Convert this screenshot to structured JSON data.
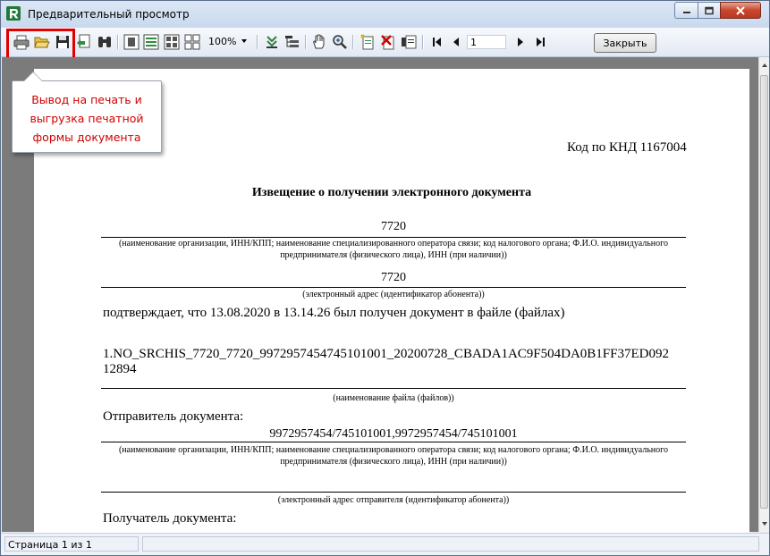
{
  "window": {
    "title": "Предварительный просмотр"
  },
  "toolbar": {
    "icons": [
      "print-icon",
      "open-icon",
      "save-icon",
      "export-icon",
      "find-icon",
      "view-one-page-icon",
      "view-page-width-icon",
      "view-multi-page-icon",
      "view-four-pages-icon",
      "outline-icon",
      "tree-icon",
      "hand-tool-icon",
      "zoom-tool-icon",
      "add-page-icon",
      "delete-page-icon",
      "edit-page-icon",
      "first-page-icon",
      "prev-page-icon",
      "next-page-icon",
      "last-page-icon"
    ],
    "zoom": "100%",
    "page_number": "1",
    "close_label": "Закрыть"
  },
  "tooltip": {
    "text": "Вывод на печать и выгрузка печатной формы документа"
  },
  "document": {
    "knd_code": "Код по КНД 1167004",
    "title": "Извещение о получении электронного документа",
    "org_value": "7720",
    "org_caption": "(наименование организации, ИНН/КПП; наименование специализированного оператора связи; код налогового органа; Ф.И.О. индивидуального предпринимателя (физического лица), ИНН (при наличии))",
    "address_value": "7720",
    "address_caption": "(электронный адрес (идентификатор абонента))",
    "confirm_text": "подтверждает, что 13.08.2020 в 13.14.26 был получен документ в файле (файлах)",
    "file_line1": "1.NO_SRCHIS_7720_7720_9972957454745101001_20200728_CBADA1AC9F504DA0B1FF37ED092",
    "file_line2": "12894",
    "file_caption": "(наименование файла (файлов))",
    "sender_label": "Отправитель документа:",
    "sender_value": "9972957454/745101001,9972957454/745101001",
    "sender_caption": "(наименование организации, ИНН/КПП; наименование специализированного оператора связи; код налогового органа; Ф.И.О. индивидуального предпринимателя (физического лица), ИНН (при наличии))",
    "sender_address_caption": "(электронный адрес отправителя (идентификатор абонента))",
    "recipient_label": "Получатель документа:"
  },
  "status": {
    "page_info": "Страница 1 из 1"
  },
  "colors": {
    "highlight": "#e00000",
    "tooltip_text": "#d00000",
    "viewport_bg": "#7b7b7b"
  }
}
